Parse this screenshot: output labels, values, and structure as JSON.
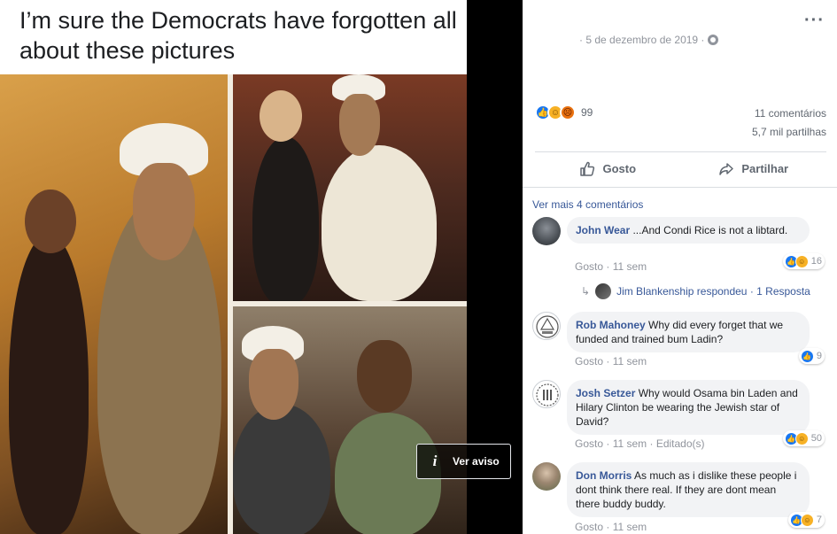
{
  "media": {
    "caption": "I’m sure the Democrats have forgotten all about these pictures",
    "warning_icon": "info-icon",
    "warning_label": "Ver aviso"
  },
  "post": {
    "date": "· 5 de dezembro de 2019 ·",
    "privacy_icon": "globe-icon",
    "more_icon": "more-options-icon",
    "reaction_total": "99",
    "comments_count": "11 comentários",
    "shares_count": "5,7 mil partilhas",
    "like_label": "Gosto",
    "share_label": "Partilhar"
  },
  "comments_section": {
    "view_more": "Ver mais 4 comentários",
    "like_link": "Gosto",
    "comments": [
      {
        "author": "John Wear",
        "text": "...And Condi Rice is not a libtard.",
        "time": "11 sem",
        "reaction_count": "16",
        "reactions": [
          "like",
          "haha"
        ]
      },
      {
        "author": "Rob Mahoney",
        "text": "Why did every forget that we funded and trained bum Ladin?",
        "time": "11 sem",
        "reaction_count": "9",
        "reactions": [
          "like"
        ]
      },
      {
        "author": "Josh Setzer",
        "text": "Why would Osama bin Laden and Hilary Clinton be wearing the Jewish star of David?",
        "time": "11 sem · Editado(s)",
        "reaction_count": "50",
        "reactions": [
          "like",
          "haha"
        ]
      },
      {
        "author": "Don Morris",
        "text": "As much as i dislike these people i dont think there real. If they are dont mean there buddy buddy.",
        "time": "11 sem",
        "reaction_count": "7",
        "reactions": [
          "like",
          "haha"
        ]
      }
    ],
    "reply": {
      "text": "Jim Blankenship respondeu · 1 Resposta"
    }
  },
  "colors": {
    "link": "#385898",
    "muted": "#90949c",
    "like_blue": "#1877f2",
    "bubble": "#f2f3f5"
  }
}
